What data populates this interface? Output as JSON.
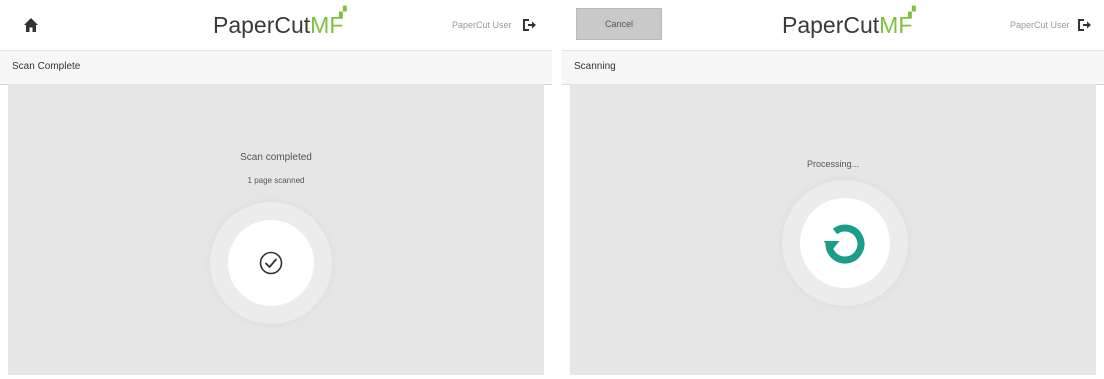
{
  "left_screen": {
    "logo": {
      "text": "PaperCut",
      "suffix": "MF"
    },
    "user_name": "PaperCut User",
    "subheader": "Scan Complete",
    "title": "Scan completed",
    "subtitle": "1 page scanned",
    "icons": {
      "home": "home-icon",
      "logout": "logout-icon",
      "status": "check-icon"
    }
  },
  "right_screen": {
    "cancel_label": "Cancel",
    "logo": {
      "text": "PaperCut",
      "suffix": "MF"
    },
    "user_name": "PaperCut User",
    "subheader": "Scanning",
    "status": "Processing...",
    "icons": {
      "logout": "logout-icon",
      "status": "refresh-icon"
    }
  },
  "colors": {
    "brand_green": "#7fbf3f",
    "spinner_teal": "#1a9e8a",
    "background_gray": "#e6e6e6"
  }
}
